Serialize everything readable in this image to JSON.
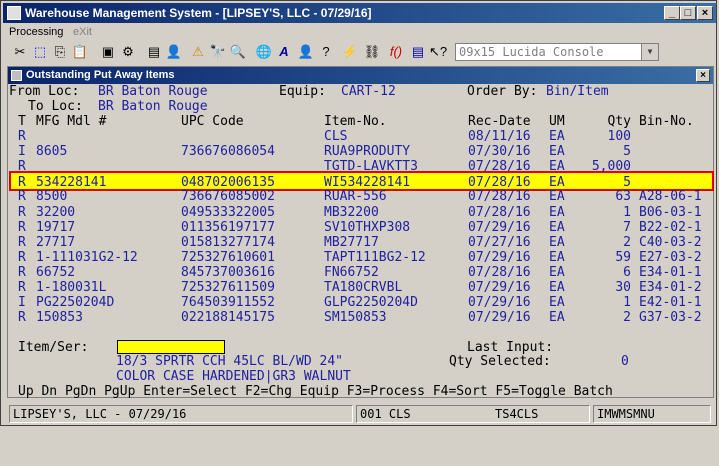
{
  "window": {
    "title": "Warehouse Management System - [LIPSEY'S, LLC - 07/29/16]"
  },
  "menu": {
    "processing": "Processing",
    "exit": "eXit"
  },
  "toolbar": {
    "font": "09x15 Lucida Console"
  },
  "panel": {
    "title": "Outstanding Put Away Items"
  },
  "header": {
    "from_label": "From Loc:",
    "from_value": "BR Baton Rouge",
    "equip_label": "Equip:",
    "equip_value": "CART-12",
    "order_label": "Order By:",
    "order_value": "Bin/Item",
    "to_label": "To Loc:",
    "to_value": "BR Baton Rouge"
  },
  "columns": {
    "t": "T",
    "mfg": "MFG Mdl #",
    "upc": "UPC Code",
    "item": "Item-No.",
    "rec": "Rec-Date",
    "um": "UM",
    "qty": "Qty",
    "bin": "Bin-No."
  },
  "rows": [
    {
      "t": "R",
      "mfg": "",
      "upc": "",
      "item": "CLS",
      "rec": "08/11/16",
      "um": "EA",
      "qty": "100",
      "bin": ""
    },
    {
      "t": "I",
      "mfg": "8605",
      "upc": "736676086054",
      "item": "RUA9PRODUTY",
      "rec": "07/30/16",
      "um": "EA",
      "qty": "5",
      "bin": ""
    },
    {
      "t": "R",
      "mfg": "",
      "upc": "",
      "item": "TGTD-LAVKTT3",
      "rec": "07/28/16",
      "um": "EA",
      "qty": "5,000",
      "bin": ""
    },
    {
      "t": "R",
      "mfg": "534228141",
      "upc": "048702006135",
      "item": "WI534228141",
      "rec": "07/28/16",
      "um": "EA",
      "qty": "5",
      "bin": ""
    },
    {
      "t": "R",
      "mfg": "8500",
      "upc": "736676085002",
      "item": "RUAR-556",
      "rec": "07/28/16",
      "um": "EA",
      "qty": "63",
      "bin": "A28-06-1"
    },
    {
      "t": "R",
      "mfg": "32200",
      "upc": "049533322005",
      "item": "MB32200",
      "rec": "07/28/16",
      "um": "EA",
      "qty": "1",
      "bin": "B06-03-1"
    },
    {
      "t": "R",
      "mfg": "19717",
      "upc": "011356197177",
      "item": "SV10THXP308",
      "rec": "07/29/16",
      "um": "EA",
      "qty": "7",
      "bin": "B22-02-1"
    },
    {
      "t": "R",
      "mfg": "27717",
      "upc": "015813277174",
      "item": "MB27717",
      "rec": "07/27/16",
      "um": "EA",
      "qty": "2",
      "bin": "C40-03-2"
    },
    {
      "t": "R",
      "mfg": "1-111031G2-12",
      "upc": "725327610601",
      "item": "TAPT111BG2-12",
      "rec": "07/29/16",
      "um": "EA",
      "qty": "59",
      "bin": "E27-03-2"
    },
    {
      "t": "R",
      "mfg": "66752",
      "upc": "845737003616",
      "item": "FN66752",
      "rec": "07/28/16",
      "um": "EA",
      "qty": "6",
      "bin": "E34-01-1"
    },
    {
      "t": "R",
      "mfg": "1-180031L",
      "upc": "725327611509",
      "item": "TA180CRVBL",
      "rec": "07/29/16",
      "um": "EA",
      "qty": "30",
      "bin": "E34-01-2"
    },
    {
      "t": "I",
      "mfg": "PG2250204D",
      "upc": "764503911552",
      "item": "GLPG2250204D",
      "rec": "07/29/16",
      "um": "EA",
      "qty": "1",
      "bin": "E42-01-1"
    },
    {
      "t": "R",
      "mfg": "150853",
      "upc": "022188145175",
      "item": "SM150853",
      "rec": "07/29/16",
      "um": "EA",
      "qty": "2",
      "bin": "G37-03-2"
    }
  ],
  "footer": {
    "item_label": "Item/Ser:",
    "last_input_label": "Last Input:",
    "qty_selected_label": "Qty Selected:",
    "qty_selected_value": "0",
    "desc1": "18/3 SPRTR CCH 45LC BL/WD 24\"",
    "desc2": "COLOR CASE HARDENED|GR3 WALNUT",
    "keys": "Up Dn PgDn PgUp Enter=Select F2=Chg Equip F3=Process F4=Sort F5=Toggle Batch"
  },
  "status": {
    "company": "LIPSEY'S, LLC - 07/29/16",
    "mid": "001 CLS",
    "term": "TS4CLS",
    "prog": "IMWMSMNU"
  },
  "colors": {
    "highlight": "#ffff00",
    "highlight_border": "#e00000",
    "data_text": "#2020a0",
    "titlebar": "#0a246a"
  }
}
